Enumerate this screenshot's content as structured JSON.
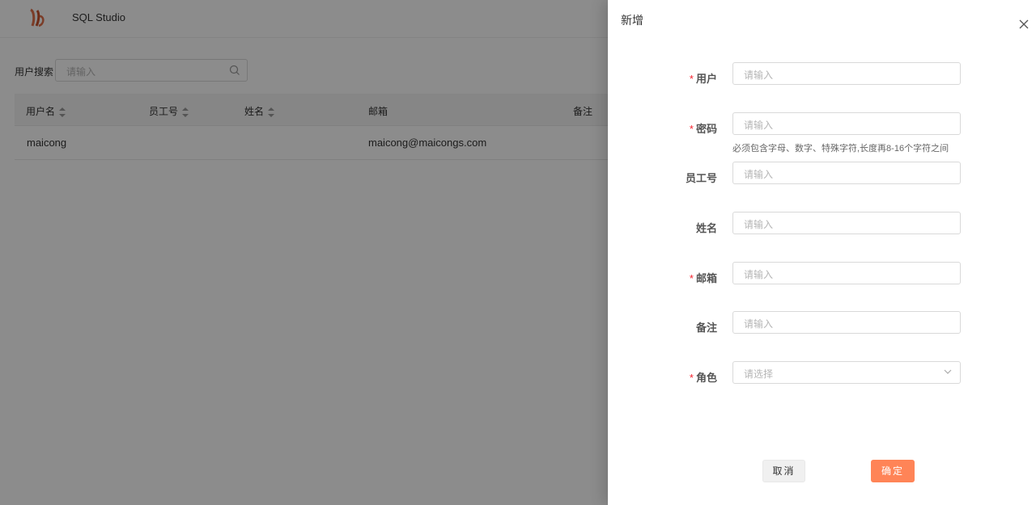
{
  "app": {
    "title": "SQL Studio",
    "accent_color": "#ff8457",
    "logo_icon": "brand-logo"
  },
  "search": {
    "label": "用户搜索",
    "placeholder": "请输入",
    "icon": "search-icon"
  },
  "table": {
    "columns": [
      {
        "label": "用户名",
        "sortable": true
      },
      {
        "label": "员工号",
        "sortable": true
      },
      {
        "label": "姓名",
        "sortable": true
      },
      {
        "label": "邮箱",
        "sortable": false
      },
      {
        "label": "备注",
        "sortable": false
      }
    ],
    "rows": [
      {
        "username": "maicong",
        "employee_no": "",
        "name": "",
        "email": "maicong@maicongs.com",
        "remark": ""
      }
    ]
  },
  "drawer": {
    "title": "新增",
    "close_icon": "close-icon",
    "fields": [
      {
        "label": "用户",
        "required": true,
        "placeholder": "请输入"
      },
      {
        "label": "密码",
        "required": true,
        "placeholder": "请输入",
        "help": "必须包含字母、数字、特殊字符,长度再8-16个字符之间"
      },
      {
        "label": "员工号",
        "required": false,
        "placeholder": "请输入"
      },
      {
        "label": "姓名",
        "required": false,
        "placeholder": "请输入"
      },
      {
        "label": "邮箱",
        "required": true,
        "placeholder": "请输入"
      },
      {
        "label": "备注",
        "required": false,
        "placeholder": "请输入"
      },
      {
        "label": "角色",
        "required": true,
        "placeholder": "请选择"
      }
    ],
    "cancel_label": "取消",
    "ok_label": "确定"
  }
}
